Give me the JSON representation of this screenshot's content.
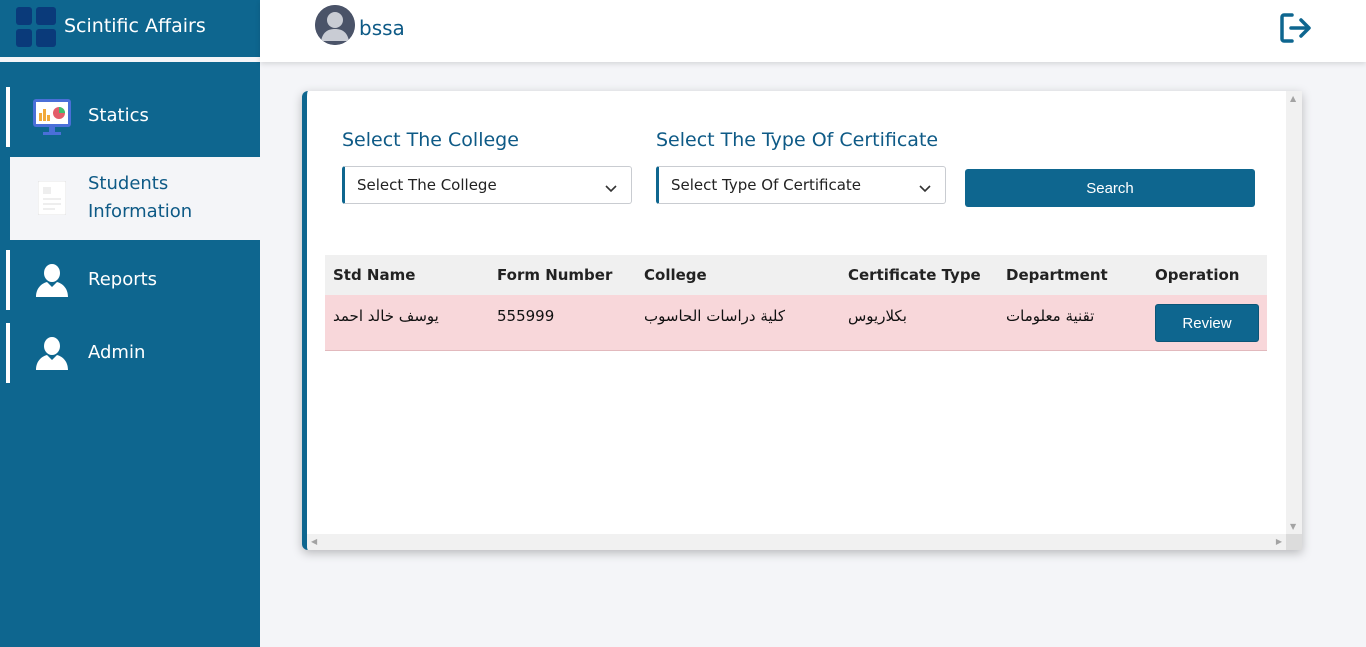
{
  "brand": {
    "title": "Scintific Affairs"
  },
  "sidebar": {
    "items": [
      {
        "label": "Statics",
        "icon": "monitor-chart-icon"
      },
      {
        "label": "Students\nInformation",
        "icon": "document-icon",
        "active": true
      },
      {
        "label": "Reports",
        "icon": "user-icon"
      },
      {
        "label": "Admin",
        "icon": "user-icon"
      }
    ]
  },
  "topbar": {
    "username": "bssa",
    "logout_icon": "logout-icon"
  },
  "filters": {
    "college_label": "Select The College",
    "college_value": "Select The College",
    "certificate_label": "Select The Type Of Certificate",
    "certificate_value": "Select Type Of Certificate",
    "search_label": "Search"
  },
  "table": {
    "headers": [
      "Std Name",
      "Form Number",
      "College",
      "Certificate Type",
      "Department",
      "Operation"
    ],
    "rows": [
      {
        "std_name": "يوسف خالد احمد",
        "form_number": "555999",
        "college": "كلية دراسات الحاسوب",
        "certificate_type": "بكلاريوس",
        "department": "تقنية معلومات",
        "operation": "Review"
      }
    ]
  },
  "colors": {
    "primary": "#0e668f",
    "row_highlight": "#f8d7da",
    "background": "#f4f5f8"
  }
}
